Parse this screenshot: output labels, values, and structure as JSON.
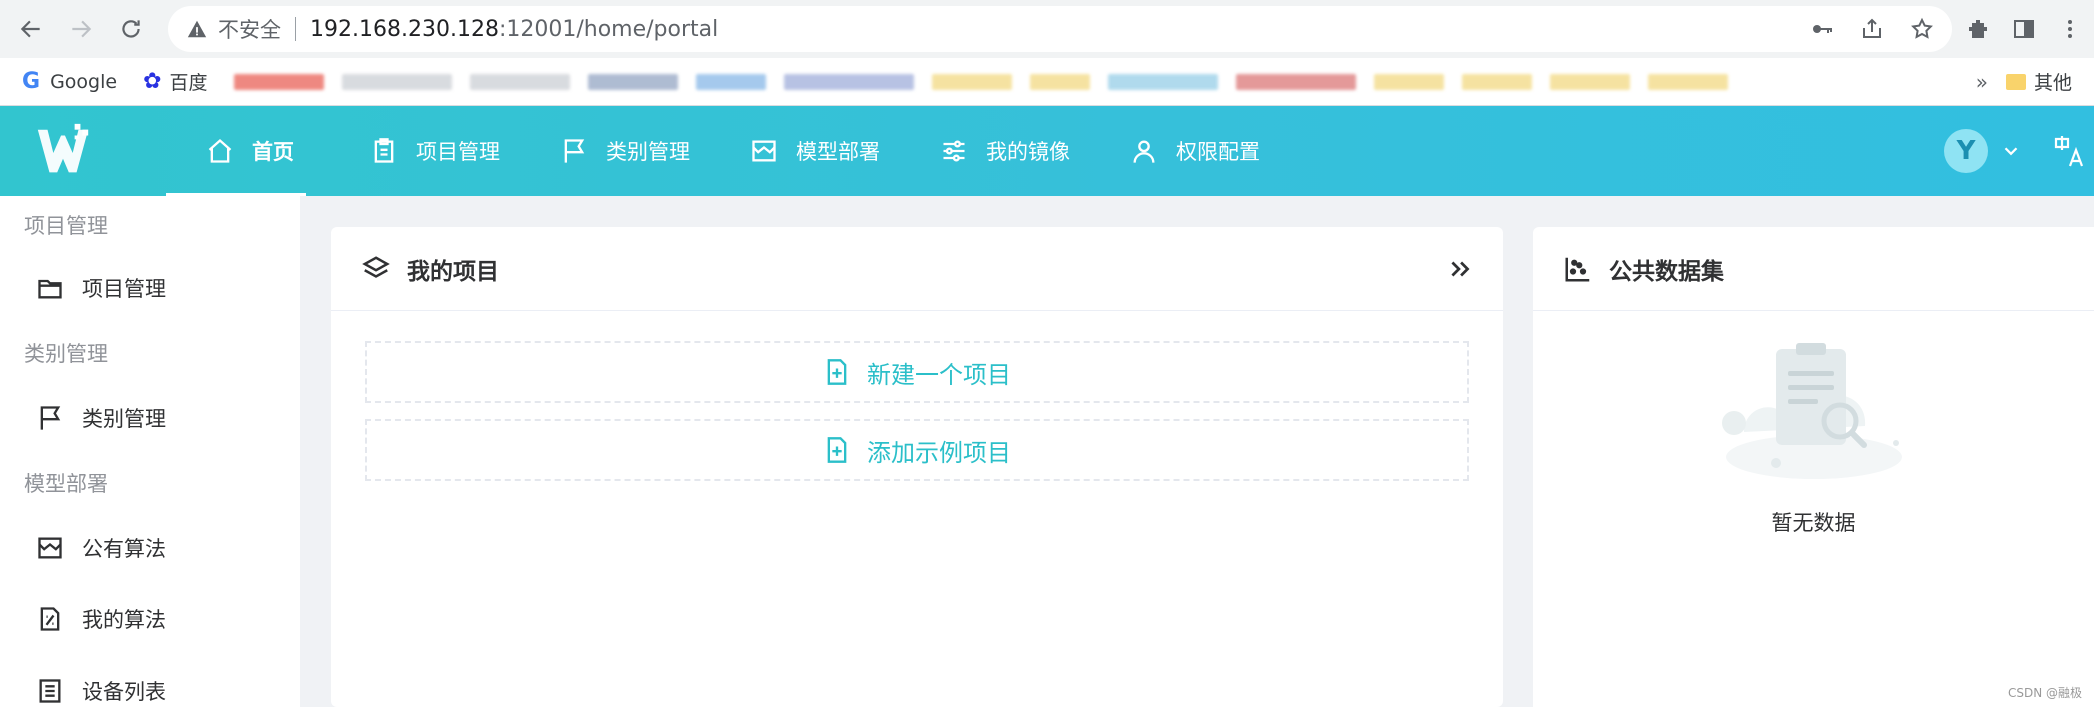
{
  "browser": {
    "insecure_label": "不安全",
    "url_host": "192.168.230.128",
    "url_rest": ":12001/home/portal",
    "bookmarks": {
      "google": "Google",
      "baidu": "百度",
      "more": "»",
      "other_folder": "其他"
    }
  },
  "header": {
    "nav": [
      {
        "label": "首页",
        "icon": "home-icon"
      },
      {
        "label": "项目管理",
        "icon": "clipboard-icon"
      },
      {
        "label": "类别管理",
        "icon": "flag-icon"
      },
      {
        "label": "模型部署",
        "icon": "store-icon"
      },
      {
        "label": "我的镜像",
        "icon": "sliders-icon"
      },
      {
        "label": "权限配置",
        "icon": "user-icon"
      }
    ],
    "avatar_letter": "Y",
    "accent": "#36c0da"
  },
  "sidebar": {
    "groups": [
      {
        "title": "项目管理",
        "items": [
          {
            "label": "项目管理",
            "icon": "folder-icon"
          }
        ]
      },
      {
        "title": "类别管理",
        "items": [
          {
            "label": "类别管理",
            "icon": "flag-icon"
          }
        ]
      },
      {
        "title": "模型部署",
        "items": [
          {
            "label": "公有算法",
            "icon": "store-icon"
          },
          {
            "label": "我的算法",
            "icon": "algorithm-icon"
          },
          {
            "label": "设备列表",
            "icon": "device-list-icon"
          }
        ]
      }
    ]
  },
  "my_projects": {
    "title": "我的项目",
    "new_project": "新建一个项目",
    "add_example": "添加示例项目"
  },
  "public_datasets": {
    "title": "公共数据集",
    "empty_text": "暂无数据"
  },
  "watermark": "CSDN @融极"
}
